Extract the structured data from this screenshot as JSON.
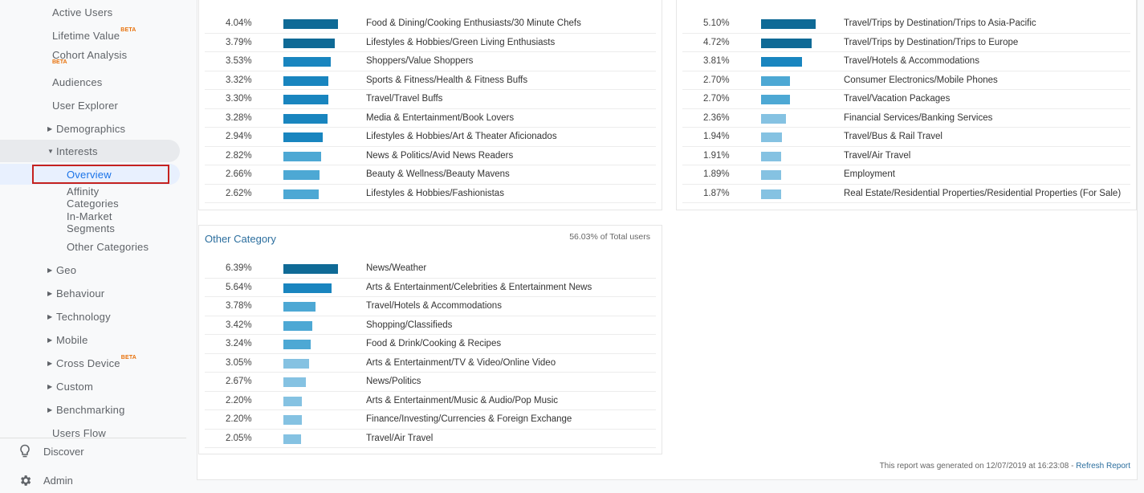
{
  "sidebar": {
    "items": [
      {
        "label": "Active Users",
        "level": 1
      },
      {
        "label": "Lifetime Value",
        "level": 1,
        "badge": "BETA"
      },
      {
        "label": "Cohort Analysis",
        "level": 1,
        "badge": "BETA"
      },
      {
        "label": "Audiences",
        "level": 1
      },
      {
        "label": "User Explorer",
        "level": 1
      },
      {
        "label": "Demographics",
        "level": 2,
        "caret": "▶"
      },
      {
        "label": "Interests",
        "level": 2,
        "caret": "▼"
      },
      {
        "label": "Overview",
        "level": 3
      },
      {
        "label": "Affinity Categories",
        "level": 3
      },
      {
        "label": "In-Market Segments",
        "level": 3
      },
      {
        "label": "Other Categories",
        "level": 3
      },
      {
        "label": "Geo",
        "level": 2,
        "caret": "▶"
      },
      {
        "label": "Behaviour",
        "level": 2,
        "caret": "▶"
      },
      {
        "label": "Technology",
        "level": 2,
        "caret": "▶"
      },
      {
        "label": "Mobile",
        "level": 2,
        "caret": "▶"
      },
      {
        "label": "Cross Device",
        "level": 2,
        "caret": "▶",
        "badge": "BETA"
      },
      {
        "label": "Custom",
        "level": 2,
        "caret": "▶"
      },
      {
        "label": "Benchmarking",
        "level": 2,
        "caret": "▶"
      },
      {
        "label": "Users Flow",
        "level": 1
      }
    ],
    "affinity_lines": [
      "Affinity",
      "Categories"
    ],
    "inmarket_lines": [
      "In-Market",
      "Segments"
    ],
    "bottom": [
      {
        "label": "Discover",
        "icon": "lightbulb-icon"
      },
      {
        "label": "Admin",
        "icon": "gear-icon"
      }
    ]
  },
  "colors": {
    "bar_dark": "#0f6a96",
    "bar_mid": "#1985bf",
    "bar_light": "#4da8d4",
    "bar_lighter": "#85c2e2",
    "link": "#2b6e9e",
    "selected_outline": "#c5221f"
  },
  "affinity_table": {
    "rows": [
      {
        "pct": "4.04%",
        "value": 4.04,
        "name": "Food & Dining/Cooking Enthusiasts/30 Minute Chefs"
      },
      {
        "pct": "3.79%",
        "value": 3.79,
        "name": "Lifestyles & Hobbies/Green Living Enthusiasts"
      },
      {
        "pct": "3.53%",
        "value": 3.53,
        "name": "Shoppers/Value Shoppers"
      },
      {
        "pct": "3.32%",
        "value": 3.32,
        "name": "Sports & Fitness/Health & Fitness Buffs"
      },
      {
        "pct": "3.30%",
        "value": 3.3,
        "name": "Travel/Travel Buffs"
      },
      {
        "pct": "3.28%",
        "value": 3.28,
        "name": "Media & Entertainment/Book Lovers"
      },
      {
        "pct": "2.94%",
        "value": 2.94,
        "name": "Lifestyles & Hobbies/Art & Theater Aficionados"
      },
      {
        "pct": "2.82%",
        "value": 2.82,
        "name": "News & Politics/Avid News Readers"
      },
      {
        "pct": "2.66%",
        "value": 2.66,
        "name": "Beauty & Wellness/Beauty Mavens"
      },
      {
        "pct": "2.62%",
        "value": 2.62,
        "name": "Lifestyles & Hobbies/Fashionistas"
      }
    ]
  },
  "inmarket_table": {
    "rows": [
      {
        "pct": "5.10%",
        "value": 5.1,
        "name": "Travel/Trips by Destination/Trips to Asia-Pacific"
      },
      {
        "pct": "4.72%",
        "value": 4.72,
        "name": "Travel/Trips by Destination/Trips to Europe"
      },
      {
        "pct": "3.81%",
        "value": 3.81,
        "name": "Travel/Hotels & Accommodations"
      },
      {
        "pct": "2.70%",
        "value": 2.7,
        "name": "Consumer Electronics/Mobile Phones"
      },
      {
        "pct": "2.70%",
        "value": 2.7,
        "name": "Travel/Vacation Packages"
      },
      {
        "pct": "2.36%",
        "value": 2.36,
        "name": "Financial Services/Banking Services"
      },
      {
        "pct": "1.94%",
        "value": 1.94,
        "name": "Travel/Bus & Rail Travel"
      },
      {
        "pct": "1.91%",
        "value": 1.91,
        "name": "Travel/Air Travel"
      },
      {
        "pct": "1.89%",
        "value": 1.89,
        "name": "Employment"
      },
      {
        "pct": "1.87%",
        "value": 1.87,
        "name": "Real Estate/Residential Properties/Residential Properties (For Sale)"
      }
    ]
  },
  "other_table": {
    "title": "Other Category",
    "subtitle": "56.03% of Total users",
    "rows": [
      {
        "pct": "6.39%",
        "value": 6.39,
        "name": "News/Weather"
      },
      {
        "pct": "5.64%",
        "value": 5.64,
        "name": "Arts & Entertainment/Celebrities & Entertainment News"
      },
      {
        "pct": "3.78%",
        "value": 3.78,
        "name": "Travel/Hotels & Accommodations"
      },
      {
        "pct": "3.42%",
        "value": 3.42,
        "name": "Shopping/Classifieds"
      },
      {
        "pct": "3.24%",
        "value": 3.24,
        "name": "Food & Drink/Cooking & Recipes"
      },
      {
        "pct": "3.05%",
        "value": 3.05,
        "name": "Arts & Entertainment/TV & Video/Online Video"
      },
      {
        "pct": "2.67%",
        "value": 2.67,
        "name": "News/Politics"
      },
      {
        "pct": "2.20%",
        "value": 2.2,
        "name": "Arts & Entertainment/Music & Audio/Pop Music"
      },
      {
        "pct": "2.20%",
        "value": 2.2,
        "name": "Finance/Investing/Currencies & Foreign Exchange"
      },
      {
        "pct": "2.05%",
        "value": 2.05,
        "name": "Travel/Air Travel"
      }
    ]
  },
  "footer": {
    "text": "This report was generated on 12/07/2019 at 16:23:08 - ",
    "link": "Refresh Report"
  }
}
